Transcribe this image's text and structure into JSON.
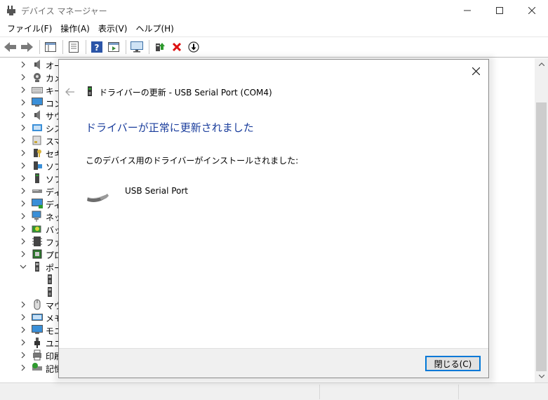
{
  "window": {
    "title": "デバイス マネージャー"
  },
  "menu": [
    "ファイル(F)",
    "操作(A)",
    "表示(V)",
    "ヘルプ(H)"
  ],
  "tree": [
    {
      "label": "オー",
      "chevron": "right",
      "icon": "audio-icon"
    },
    {
      "label": "カメ",
      "chevron": "right",
      "icon": "camera-icon"
    },
    {
      "label": "キー",
      "chevron": "right",
      "icon": "keyboard-icon"
    },
    {
      "label": "コン",
      "chevron": "right",
      "icon": "computer-icon"
    },
    {
      "label": "サウ",
      "chevron": "right",
      "icon": "sound-icon"
    },
    {
      "label": "シス",
      "chevron": "right",
      "icon": "system-icon"
    },
    {
      "label": "スマ",
      "chevron": "right",
      "icon": "smartcard-icon"
    },
    {
      "label": "セキ",
      "chevron": "right",
      "icon": "security-icon"
    },
    {
      "label": "ソフ",
      "chevron": "right",
      "icon": "software-component-icon"
    },
    {
      "label": "ソフ",
      "chevron": "right",
      "icon": "software-device-icon"
    },
    {
      "label": "ディ",
      "chevron": "right",
      "icon": "disk-drive-icon"
    },
    {
      "label": "ディ",
      "chevron": "right",
      "icon": "display-adapter-icon"
    },
    {
      "label": "ネッ",
      "chevron": "right",
      "icon": "network-icon"
    },
    {
      "label": "バッ",
      "chevron": "right",
      "icon": "battery-icon"
    },
    {
      "label": "ファ",
      "chevron": "right",
      "icon": "firmware-icon"
    },
    {
      "label": "プロ",
      "chevron": "right",
      "icon": "processor-icon"
    },
    {
      "label": "ポー",
      "chevron": "down",
      "icon": "port-icon"
    },
    {
      "label": "",
      "chevron": "none",
      "icon": "port-child-icon"
    },
    {
      "label": "",
      "chevron": "none",
      "icon": "port-child-icon"
    },
    {
      "label": "マウ",
      "chevron": "right",
      "icon": "mouse-icon"
    },
    {
      "label": "メモ",
      "chevron": "right",
      "icon": "memory-icon"
    },
    {
      "label": "モニ",
      "chevron": "right",
      "icon": "monitor-icon"
    },
    {
      "label": "ユニ",
      "chevron": "right",
      "icon": "usb-icon"
    },
    {
      "label": "印刷",
      "chevron": "right",
      "icon": "print-queue-icon"
    },
    {
      "label": "記憶",
      "chevron": "right",
      "icon": "storage-icon"
    }
  ],
  "dialog": {
    "title": "ドライバーの更新 - USB Serial Port (COM4)",
    "heading": "ドライバーが正常に更新されました",
    "description": "このデバイス用のドライバーがインストールされました:",
    "device_name": "USB Serial Port",
    "close_button": "閉じる(C)"
  },
  "colors": {
    "heading": "#1a3d9c",
    "accent": "#0078d7"
  }
}
